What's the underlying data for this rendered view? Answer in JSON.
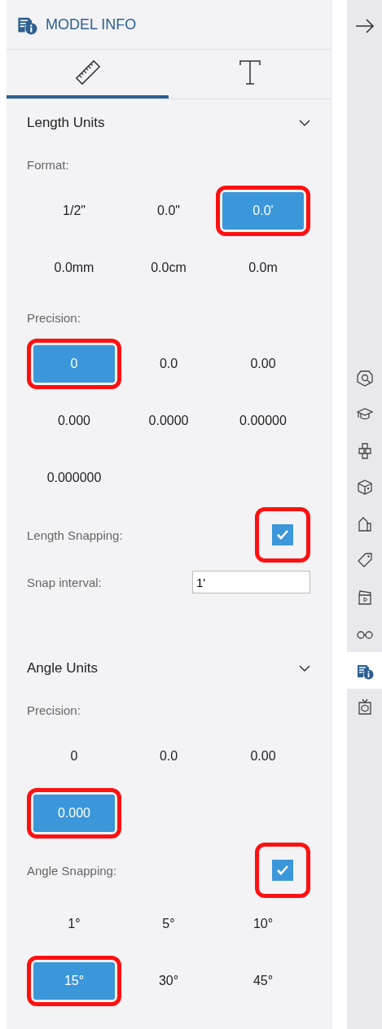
{
  "panel": {
    "title": "MODEL INFO"
  },
  "tabs": [
    {
      "selected": true
    },
    {
      "selected": false
    }
  ],
  "sections": [
    {
      "title": "Length Units",
      "expanded": true,
      "items": [
        {
          "kind": "options",
          "label": "Format:",
          "options": [
            {
              "label": "1/2\"",
              "selected": false,
              "highlighted": false
            },
            {
              "label": "0.0\"",
              "selected": false,
              "highlighted": false
            },
            {
              "label": "0.0'",
              "selected": true,
              "highlighted": true
            },
            {
              "label": "0.0mm",
              "selected": false,
              "highlighted": false
            },
            {
              "label": "0.0cm",
              "selected": false,
              "highlighted": false
            },
            {
              "label": "0.0m",
              "selected": false,
              "highlighted": false
            }
          ]
        },
        {
          "kind": "options",
          "label": "Precision:",
          "options": [
            {
              "label": "0",
              "selected": true,
              "highlighted": true
            },
            {
              "label": "0.0",
              "selected": false,
              "highlighted": false
            },
            {
              "label": "0.00",
              "selected": false,
              "highlighted": false
            },
            {
              "label": "0.000",
              "selected": false,
              "highlighted": false
            },
            {
              "label": "0.0000",
              "selected": false,
              "highlighted": false
            },
            {
              "label": "0.00000",
              "selected": false,
              "highlighted": false
            },
            {
              "label": "0.000000",
              "selected": false,
              "highlighted": false
            }
          ]
        },
        {
          "kind": "toggle",
          "label": "Length Snapping:",
          "checked": true,
          "highlighted": true
        },
        {
          "kind": "field",
          "label": "Snap interval:",
          "value": "1'"
        }
      ]
    },
    {
      "title": "Angle Units",
      "expanded": true,
      "items": [
        {
          "kind": "options",
          "label": "Precision:",
          "options": [
            {
              "label": "0",
              "selected": false,
              "highlighted": false
            },
            {
              "label": "0.0",
              "selected": false,
              "highlighted": false
            },
            {
              "label": "0.00",
              "selected": false,
              "highlighted": false
            },
            {
              "label": "0.000",
              "selected": true,
              "highlighted": true
            }
          ]
        },
        {
          "kind": "toggle",
          "label": "Angle Snapping:",
          "checked": true,
          "highlighted": true
        },
        {
          "kind": "options",
          "options": [
            {
              "label": "1°",
              "selected": false,
              "highlighted": false
            },
            {
              "label": "5°",
              "selected": false,
              "highlighted": false
            },
            {
              "label": "10°",
              "selected": false,
              "highlighted": false
            },
            {
              "label": "15°",
              "selected": true,
              "highlighted": true
            },
            {
              "label": "30°",
              "selected": false,
              "highlighted": false
            },
            {
              "label": "45°",
              "selected": false,
              "highlighted": false
            }
          ]
        }
      ]
    }
  ],
  "sidebar": {
    "items": [
      {
        "selected": false
      },
      {
        "selected": false
      },
      {
        "selected": false
      },
      {
        "selected": false
      },
      {
        "selected": false
      },
      {
        "selected": false
      },
      {
        "selected": false
      },
      {
        "selected": false
      },
      {
        "selected": true
      },
      {
        "selected": false
      }
    ]
  }
}
